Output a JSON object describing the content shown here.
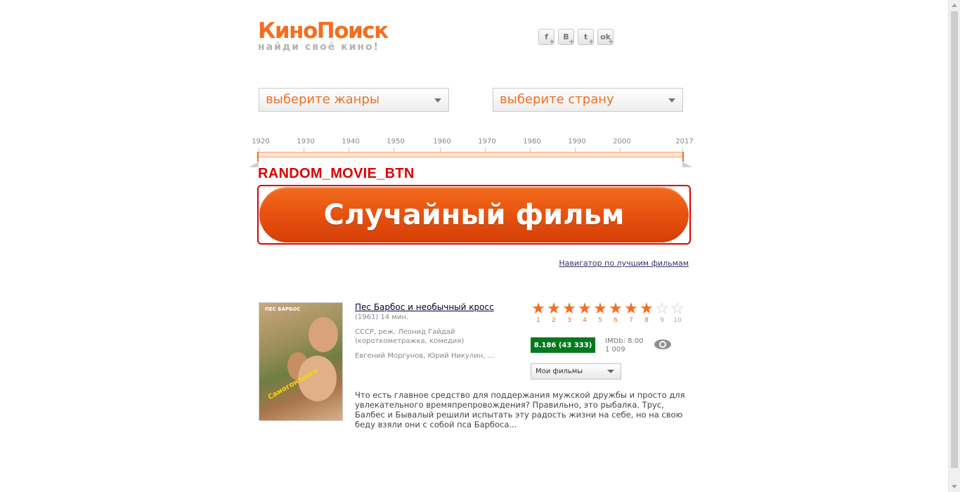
{
  "logo": {
    "name": "КиноПоиск",
    "tagline": "найди своё кино!"
  },
  "social": [
    {
      "icon": "facebook-icon",
      "glyph": "f"
    },
    {
      "icon": "vkontakte-icon",
      "glyph": "B"
    },
    {
      "icon": "twitter-icon",
      "glyph": "t"
    },
    {
      "icon": "odnoklassniki-icon",
      "glyph": "ok"
    }
  ],
  "filters": {
    "genre_label": "выберите жанры",
    "country_label": "выберите страну"
  },
  "timeline": {
    "years": [
      "1920",
      "1930",
      "1940",
      "1950",
      "1960",
      "1970",
      "1980",
      "1990",
      "2000",
      "2017"
    ],
    "range_start": "1920",
    "range_end": "2017"
  },
  "annotation": "RANDOM_MOVIE_BTN",
  "random_button_label": "Случайный фильм",
  "navigator_link": "Навигатор по лучшим фильмам",
  "movie": {
    "title": "Пес Барбос и необычный кросс",
    "year_length": "(1961) 14 мин.",
    "country_director": "СССР, реж. Леонид Гайдай",
    "genres": "(короткометражка, комедия)",
    "cast": "Евгений Моргунов, Юрий Никулин, ...",
    "poster_top_text": "ПЕС БАРБОС",
    "poster_side_text": "Самогонщики",
    "rating_scale": [
      "1",
      "2",
      "3",
      "4",
      "5",
      "6",
      "7",
      "8",
      "9",
      "10"
    ],
    "rating_filled": 8,
    "kp_rating": "8.186 (43 333)",
    "imdb_rating": "IMDb: 8.00",
    "imdb_votes": "1 009",
    "my_films_label": "Мои фильмы",
    "description": "Что есть главное средство для поддержания мужской дружбы и просто для увлекательного времяпрепровождения? Правильно, это рыбалка. Трус, Балбес и Бывалый решили испытать эту радость жизни на себе, но на свою беду взяли они с собой пса Барбоса..."
  },
  "colors": {
    "brand_orange": "#f26f21",
    "rating_green": "#007a1e",
    "annotation_red": "#dd0000"
  }
}
